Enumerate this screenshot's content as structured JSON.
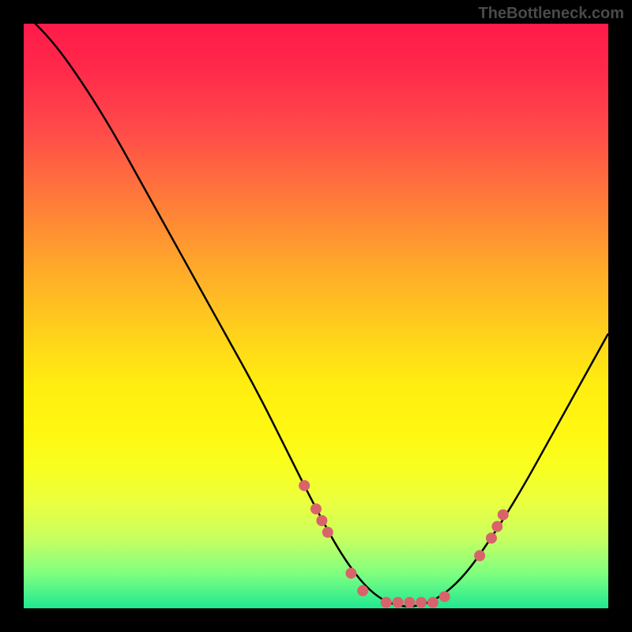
{
  "watermark": "TheBottleneck.com",
  "chart_data": {
    "type": "line",
    "title": "",
    "xlabel": "",
    "ylabel": "",
    "xlim": [
      0,
      100
    ],
    "ylim": [
      0,
      100
    ],
    "series": [
      {
        "name": "bottleneck-curve",
        "x": [
          0,
          5,
          10,
          15,
          20,
          25,
          30,
          35,
          40,
          45,
          50,
          55,
          60,
          65,
          70,
          75,
          80,
          85,
          90,
          95,
          100
        ],
        "y": [
          102,
          97,
          90,
          82,
          73,
          64,
          55,
          46,
          37,
          27,
          17,
          8,
          2,
          0,
          1,
          5,
          12,
          20,
          29,
          38,
          47
        ]
      }
    ],
    "points": {
      "name": "highlighted-points",
      "color": "#d9636b",
      "x": [
        48,
        50,
        51,
        52,
        56,
        58,
        62,
        64,
        66,
        68,
        70,
        72,
        78,
        80,
        81,
        82
      ],
      "y": [
        21,
        17,
        15,
        13,
        6,
        3,
        1,
        1,
        1,
        1,
        1,
        2,
        9,
        12,
        14,
        16
      ]
    },
    "background_gradient": {
      "top": "#ff1a4a",
      "middle": "#ffee10",
      "bottom": "#20e890"
    }
  }
}
